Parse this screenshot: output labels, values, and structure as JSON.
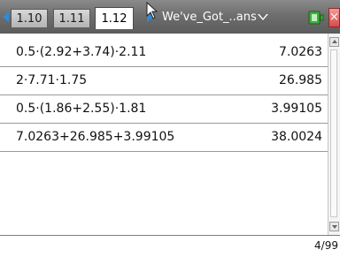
{
  "tabs": [
    {
      "label": "1.10",
      "active": false
    },
    {
      "label": "1.11",
      "active": false
    },
    {
      "label": "1.12",
      "active": true
    }
  ],
  "document": {
    "title": "We've_Got_..ans"
  },
  "icons": {
    "prev_page": "arrow-left-icon",
    "next_page": "arrow-right-icon",
    "cursor": "mouse-pointer-icon",
    "document_menu": "chevron-down-icon",
    "battery": "battery-icon",
    "close": "close-icon"
  },
  "colors": {
    "tab_arrow": "#2e8bdb",
    "title_bar": "#6e6e6e",
    "close": "#d94a4a"
  },
  "calculator": {
    "history": [
      {
        "expression": "0.5·(2.92+3.74)·2.11",
        "result": "7.0263"
      },
      {
        "expression": "2·7.71·1.75",
        "result": "26.985"
      },
      {
        "expression": "0.5·(1.86+2.55)·1.81",
        "result": "3.99105"
      },
      {
        "expression": "7.0263+26.985+3.99105",
        "result": "38.0024"
      }
    ],
    "entry_value": "",
    "history_count": "4/99"
  }
}
